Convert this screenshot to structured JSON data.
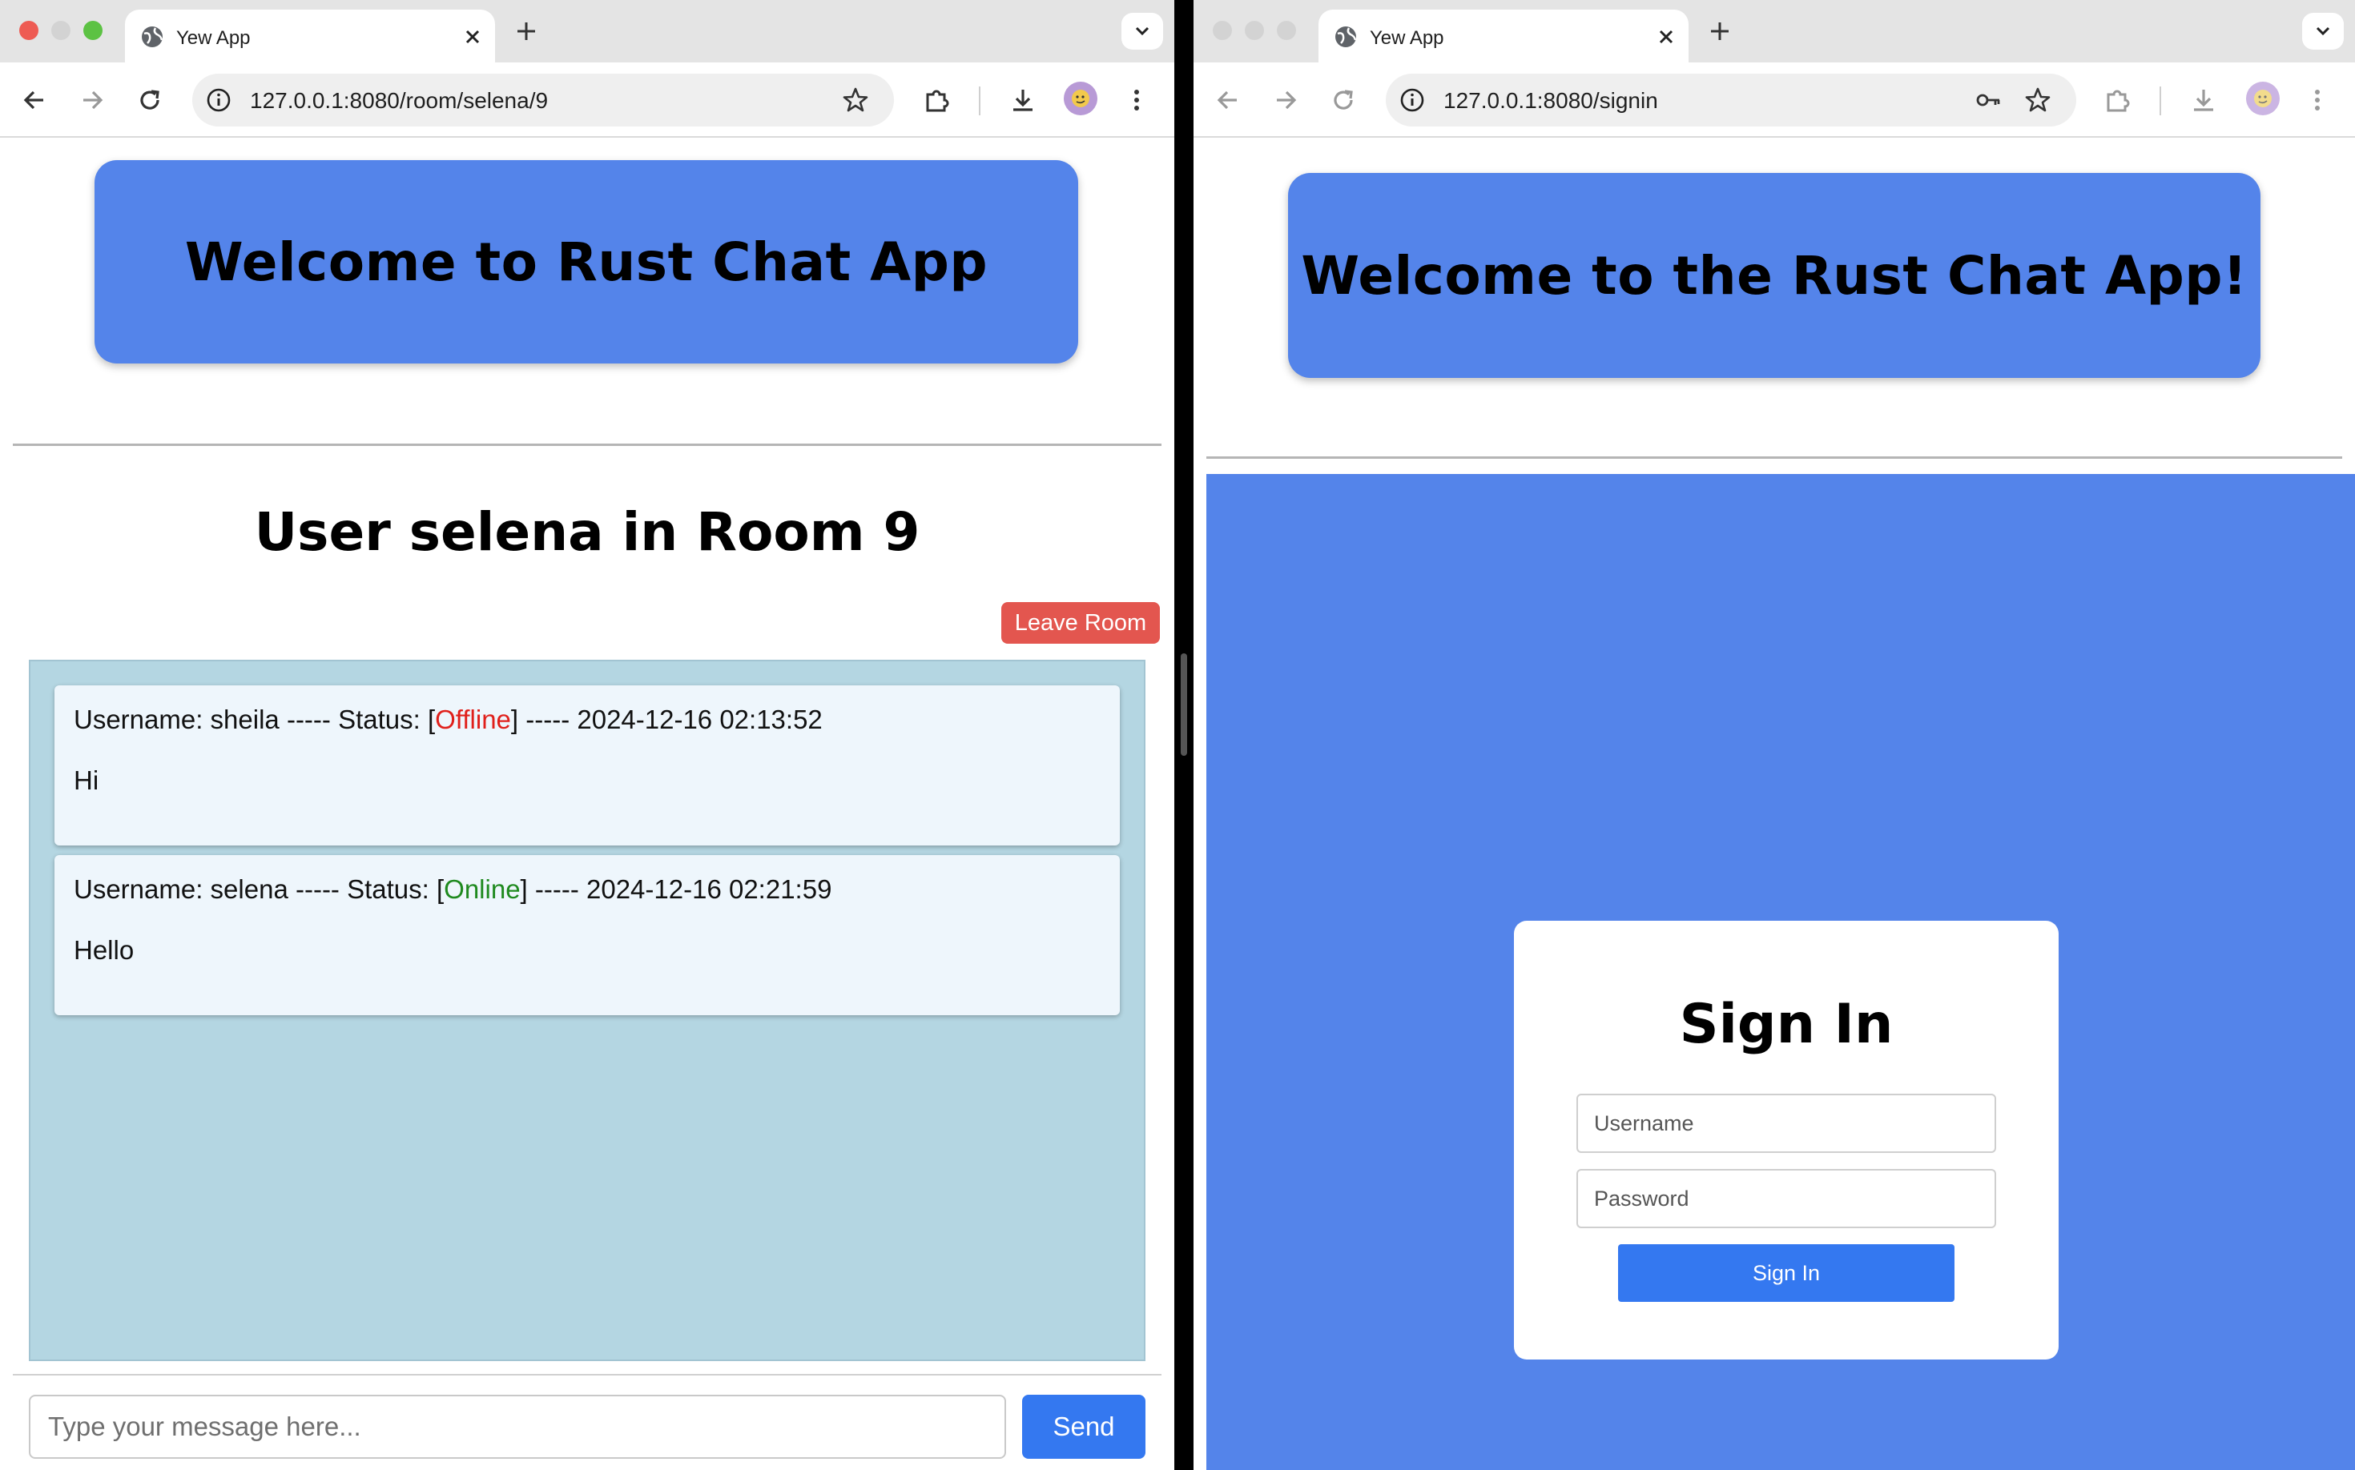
{
  "left_window": {
    "tab": {
      "title": "Yew App"
    },
    "address": {
      "url": "127.0.0.1:8080/room/selena/9"
    },
    "page": {
      "banner_title": "Welcome to Rust Chat App",
      "room_title": "User selena in Room 9",
      "leave_button": "Leave Room",
      "messages": [
        {
          "prefix": "Username: sheila ----- Status: [",
          "status": "Offline",
          "suffix": "] ----- 2024-12-16 02:13:52",
          "text": "Hi"
        },
        {
          "prefix": "Username: selena ----- Status: [",
          "status": "Online",
          "suffix": "] ----- 2024-12-16 02:21:59",
          "text": "Hello"
        }
      ],
      "input_placeholder": "Type your message here...",
      "send_button": "Send"
    }
  },
  "right_window": {
    "tab": {
      "title": "Yew App"
    },
    "address": {
      "url": "127.0.0.1:8080/signin"
    },
    "page": {
      "banner_title": "Welcome to the Rust Chat App!",
      "signin_heading": "Sign In",
      "username_placeholder": "Username",
      "password_placeholder": "Password",
      "signin_button": "Sign In"
    }
  },
  "colors": {
    "banner": "#5484ea",
    "leave_button": "#e3564f",
    "send_button": "#3478f0",
    "message_area": "#b4d6e2",
    "status_offline": "#e0201b",
    "status_online": "#1f8a1f"
  },
  "icons": [
    "globe-icon",
    "close-icon",
    "plus-icon",
    "chevron-down-icon",
    "back-arrow-icon",
    "forward-arrow-icon",
    "reload-icon",
    "info-icon",
    "star-icon",
    "key-icon",
    "extensions-icon",
    "download-icon",
    "profile-avatar",
    "kebab-menu-icon"
  ]
}
